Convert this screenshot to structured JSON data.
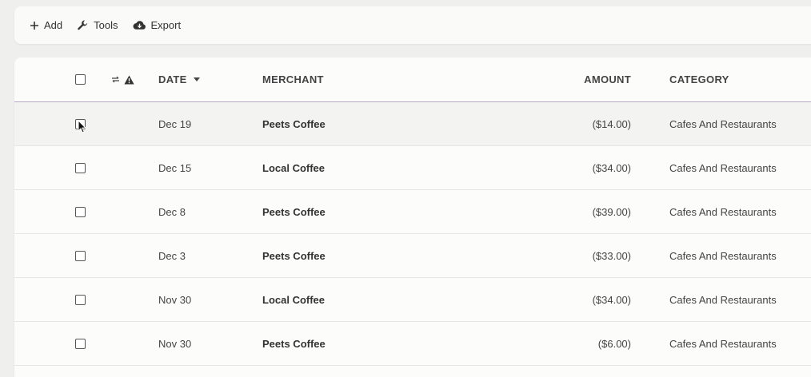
{
  "toolbar": {
    "add_label": "Add",
    "tools_label": "Tools",
    "export_label": "Export"
  },
  "table": {
    "columns": {
      "date": "DATE",
      "merchant": "MERCHANT",
      "amount": "AMOUNT",
      "category": "CATEGORY"
    },
    "sort": {
      "column": "date",
      "direction": "descending"
    },
    "rows": [
      {
        "date": "Dec 19",
        "merchant": "Peets Coffee",
        "amount": "($14.00)",
        "category": "Cafes And Restaurants",
        "hovered": true
      },
      {
        "date": "Dec 15",
        "merchant": "Local Coffee",
        "amount": "($34.00)",
        "category": "Cafes And Restaurants"
      },
      {
        "date": "Dec 8",
        "merchant": "Peets Coffee",
        "amount": "($39.00)",
        "category": "Cafes And Restaurants"
      },
      {
        "date": "Dec 3",
        "merchant": "Peets Coffee",
        "amount": "($33.00)",
        "category": "Cafes And Restaurants"
      },
      {
        "date": "Nov 30",
        "merchant": "Local Coffee",
        "amount": "($34.00)",
        "category": "Cafes And Restaurants"
      },
      {
        "date": "Nov 30",
        "merchant": "Peets Coffee",
        "amount": "($6.00)",
        "category": "Cafes And Restaurants"
      }
    ]
  },
  "icons": {
    "add": "plus-icon",
    "tools": "wrench-icon",
    "export": "cloud-download-icon",
    "header_flags": [
      "transfer-arrows-icon",
      "warning-triangle-icon"
    ]
  },
  "colors": {
    "header_divider": "#b7a8c5",
    "row_hover": "#f3f3f2"
  }
}
